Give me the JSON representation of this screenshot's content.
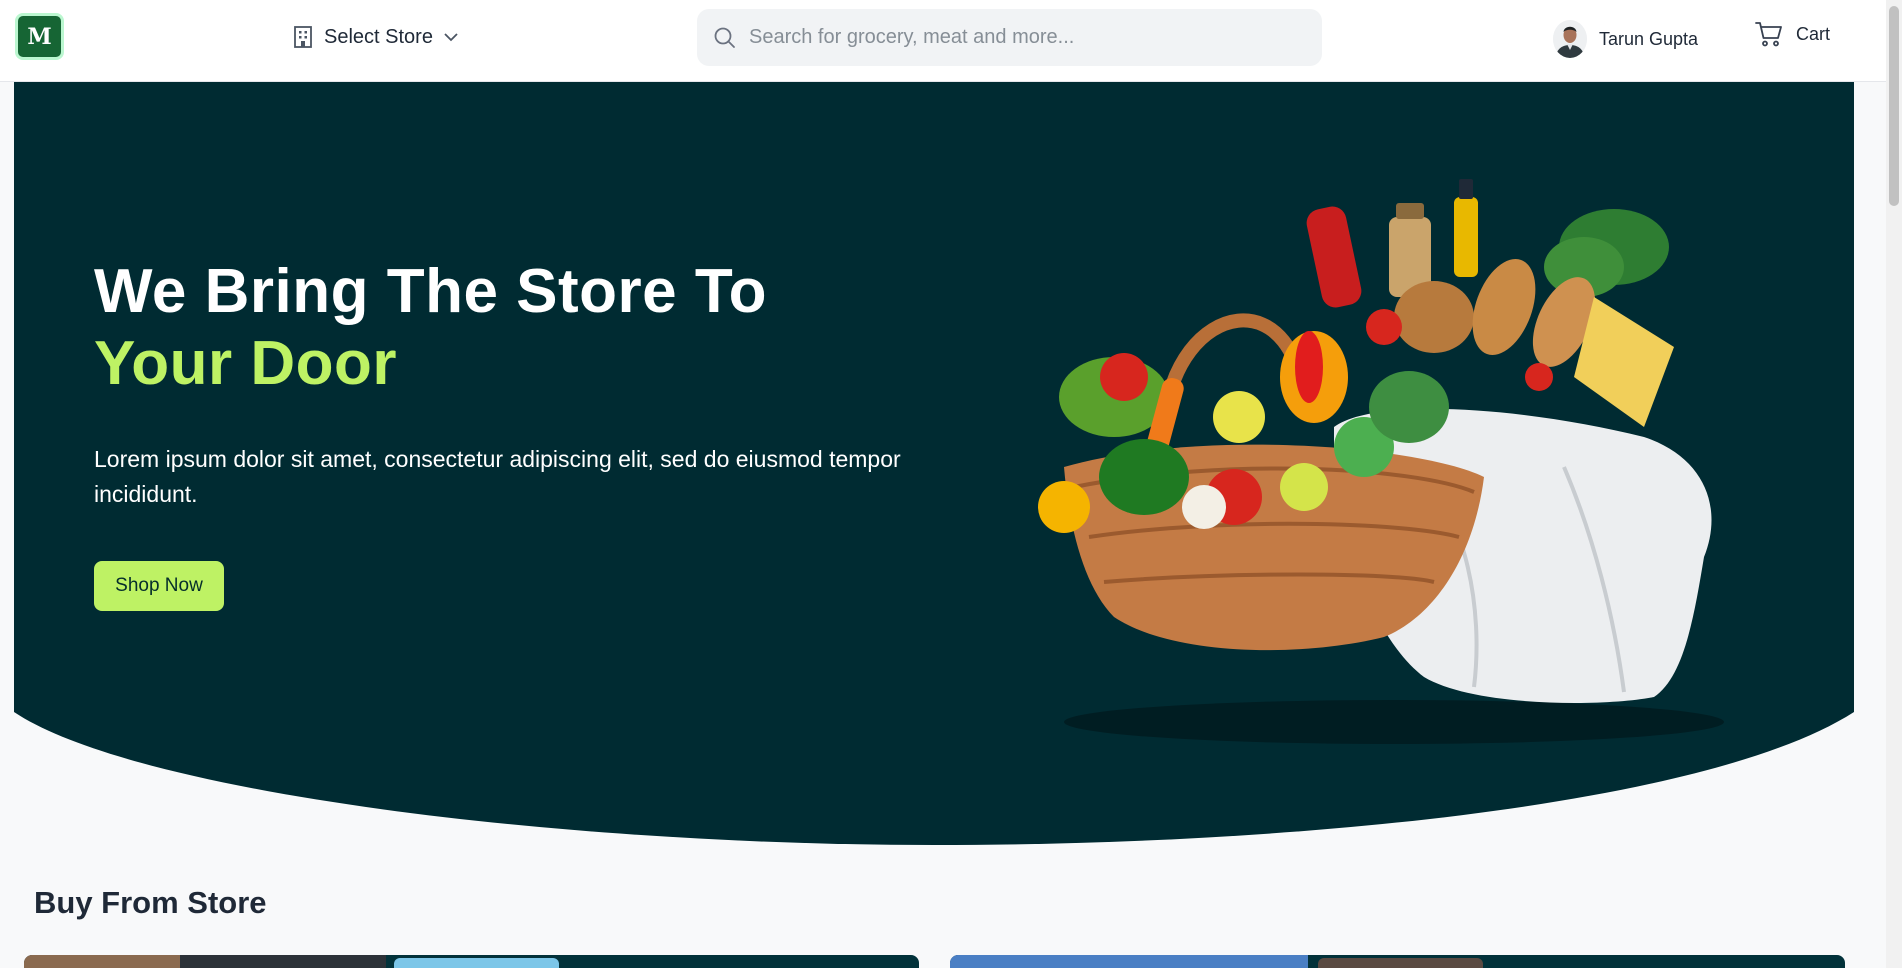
{
  "header": {
    "logo_text": "M",
    "store_select_label": "Select Store",
    "search_placeholder": "Search for grocery, meat and more...",
    "user_name": "Tarun Gupta",
    "cart_label": "Cart"
  },
  "hero": {
    "title_line1": "We Bring The Store To",
    "title_line2": "Your Door",
    "description": "Lorem ipsum dolor sit amet, consectetur adipiscing elit, sed do eiusmod tempor incididunt.",
    "cta_label": "Shop Now"
  },
  "section": {
    "title": "Buy From Store"
  },
  "colors": {
    "hero_bg": "#002b32",
    "accent": "#bef264",
    "brand": "#166534"
  },
  "icons": [
    "building-icon",
    "chevron-down-icon",
    "search-icon",
    "cart-icon"
  ]
}
